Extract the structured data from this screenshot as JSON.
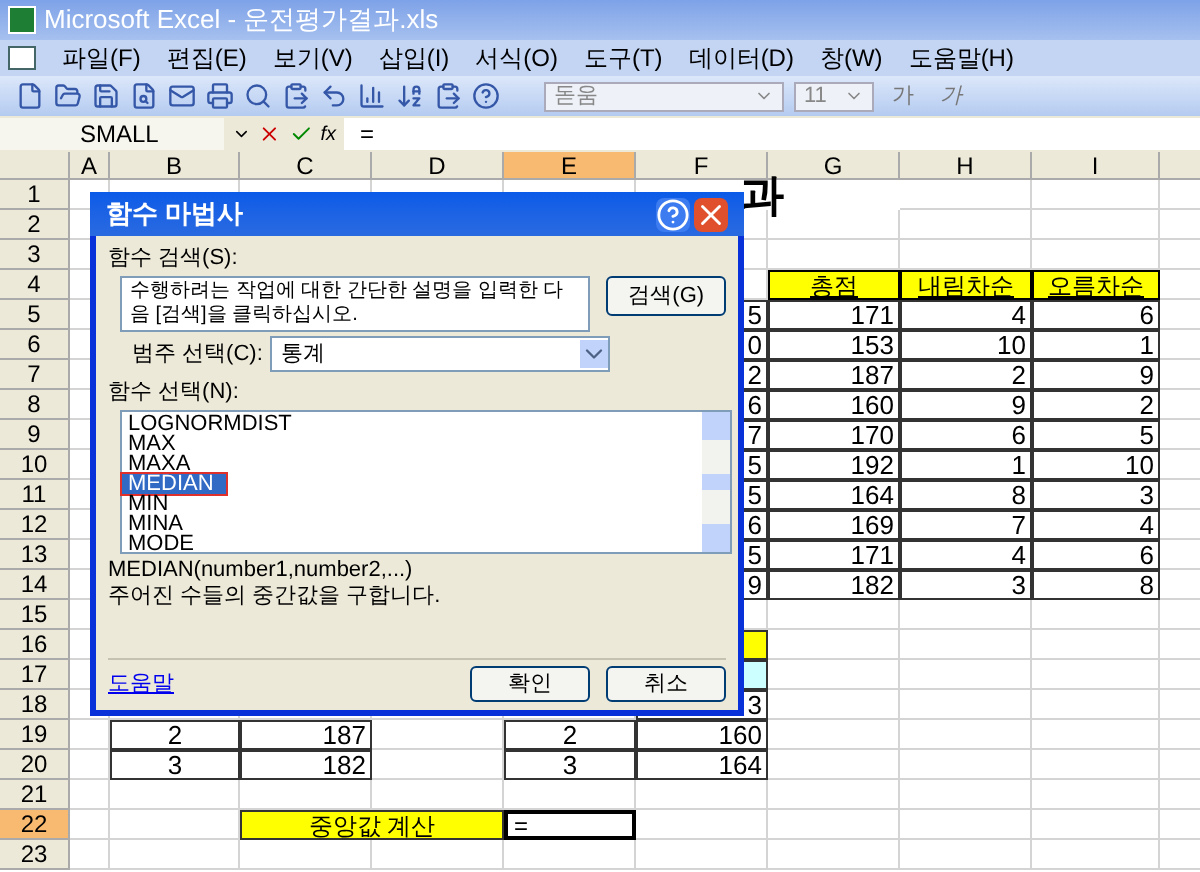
{
  "window": {
    "title": "Microsoft Excel - 운전평가결과.xls"
  },
  "menu": [
    "파일(F)",
    "편집(E)",
    "보기(V)",
    "삽입(I)",
    "서식(O)",
    "도구(T)",
    "데이터(D)",
    "창(W)",
    "도움말(H)"
  ],
  "font_toolbar": {
    "font": "돋움",
    "size": "11",
    "buttons": [
      "가",
      "가"
    ]
  },
  "formula_bar": {
    "name_box": "SMALL",
    "fx_button": "fx",
    "formula": "="
  },
  "columns": [
    {
      "label": "A",
      "selected": false
    },
    {
      "label": "B",
      "selected": false
    },
    {
      "label": "C",
      "selected": false
    },
    {
      "label": "D",
      "selected": false
    },
    {
      "label": "E",
      "selected": true
    },
    {
      "label": "F",
      "selected": false
    },
    {
      "label": "G",
      "selected": false
    },
    {
      "label": "H",
      "selected": false
    },
    {
      "label": "I",
      "selected": false
    }
  ],
  "rows": [
    {
      "label": "1",
      "selected": false,
      "cells": [
        {
          "kind": "empty"
        },
        {
          "kind": "empty"
        },
        {
          "kind": "empty"
        },
        {
          "kind": "empty"
        },
        {
          "kind": "empty"
        },
        {
          "kind": "title",
          "text": "과"
        }
      ]
    },
    {
      "label": "2",
      "selected": false
    },
    {
      "label": "3",
      "selected": false
    },
    {
      "label": "4",
      "selected": false,
      "cells": [
        {
          "kind": "empty"
        },
        {
          "kind": "empty"
        },
        {
          "kind": "empty"
        },
        {
          "kind": "empty"
        },
        {
          "kind": "empty"
        },
        {
          "kind": "empty"
        },
        {
          "kind": "header",
          "text": "총점"
        },
        {
          "kind": "header",
          "text": "내림차순"
        },
        {
          "kind": "header",
          "text": "오름차순"
        }
      ]
    },
    {
      "label": "5",
      "selected": false,
      "cells": [
        {
          "kind": "empty"
        },
        {
          "kind": "empty"
        },
        {
          "kind": "empty"
        },
        {
          "kind": "empty"
        },
        {
          "kind": "empty"
        },
        {
          "kind": "number",
          "text": "5"
        },
        {
          "kind": "number",
          "text": "171"
        },
        {
          "kind": "number",
          "text": "4"
        },
        {
          "kind": "number",
          "text": "6"
        }
      ]
    },
    {
      "label": "6",
      "selected": false,
      "cells": [
        {
          "kind": "empty"
        },
        {
          "kind": "empty"
        },
        {
          "kind": "empty"
        },
        {
          "kind": "empty"
        },
        {
          "kind": "empty"
        },
        {
          "kind": "number",
          "text": "0"
        },
        {
          "kind": "number",
          "text": "153"
        },
        {
          "kind": "number",
          "text": "10"
        },
        {
          "kind": "number",
          "text": "1"
        }
      ]
    },
    {
      "label": "7",
      "selected": false,
      "cells": [
        {
          "kind": "empty"
        },
        {
          "kind": "empty"
        },
        {
          "kind": "empty"
        },
        {
          "kind": "empty"
        },
        {
          "kind": "empty"
        },
        {
          "kind": "number",
          "text": "2"
        },
        {
          "kind": "number",
          "text": "187"
        },
        {
          "kind": "number",
          "text": "2"
        },
        {
          "kind": "number",
          "text": "9"
        }
      ]
    },
    {
      "label": "8",
      "selected": false,
      "cells": [
        {
          "kind": "empty"
        },
        {
          "kind": "empty"
        },
        {
          "kind": "empty"
        },
        {
          "kind": "empty"
        },
        {
          "kind": "empty"
        },
        {
          "kind": "number",
          "text": "6"
        },
        {
          "kind": "number",
          "text": "160"
        },
        {
          "kind": "number",
          "text": "9"
        },
        {
          "kind": "number",
          "text": "2"
        }
      ]
    },
    {
      "label": "9",
      "selected": false,
      "cells": [
        {
          "kind": "empty"
        },
        {
          "kind": "empty"
        },
        {
          "kind": "empty"
        },
        {
          "kind": "empty"
        },
        {
          "kind": "empty"
        },
        {
          "kind": "number",
          "text": "7"
        },
        {
          "kind": "number",
          "text": "170"
        },
        {
          "kind": "number",
          "text": "6"
        },
        {
          "kind": "number",
          "text": "5"
        }
      ]
    },
    {
      "label": "10",
      "selected": false,
      "cells": [
        {
          "kind": "empty"
        },
        {
          "kind": "empty"
        },
        {
          "kind": "empty"
        },
        {
          "kind": "empty"
        },
        {
          "kind": "empty"
        },
        {
          "kind": "number",
          "text": "5"
        },
        {
          "kind": "number",
          "text": "192"
        },
        {
          "kind": "number",
          "text": "1"
        },
        {
          "kind": "number",
          "text": "10"
        }
      ]
    },
    {
      "label": "11",
      "selected": false,
      "cells": [
        {
          "kind": "empty"
        },
        {
          "kind": "empty"
        },
        {
          "kind": "empty"
        },
        {
          "kind": "empty"
        },
        {
          "kind": "empty"
        },
        {
          "kind": "number",
          "text": "5"
        },
        {
          "kind": "number",
          "text": "164"
        },
        {
          "kind": "number",
          "text": "8"
        },
        {
          "kind": "number",
          "text": "3"
        }
      ]
    },
    {
      "label": "12",
      "selected": false,
      "cells": [
        {
          "kind": "empty"
        },
        {
          "kind": "empty"
        },
        {
          "kind": "empty"
        },
        {
          "kind": "empty"
        },
        {
          "kind": "empty"
        },
        {
          "kind": "number",
          "text": "6"
        },
        {
          "kind": "number",
          "text": "169"
        },
        {
          "kind": "number",
          "text": "7"
        },
        {
          "kind": "number",
          "text": "4"
        }
      ]
    },
    {
      "label": "13",
      "selected": false,
      "cells": [
        {
          "kind": "empty"
        },
        {
          "kind": "empty"
        },
        {
          "kind": "empty"
        },
        {
          "kind": "empty"
        },
        {
          "kind": "empty"
        },
        {
          "kind": "number",
          "text": "5"
        },
        {
          "kind": "number",
          "text": "171"
        },
        {
          "kind": "number",
          "text": "4"
        },
        {
          "kind": "number",
          "text": "6"
        }
      ]
    },
    {
      "label": "14",
      "selected": false,
      "cells": [
        {
          "kind": "empty"
        },
        {
          "kind": "empty"
        },
        {
          "kind": "empty"
        },
        {
          "kind": "empty"
        },
        {
          "kind": "empty"
        },
        {
          "kind": "number",
          "text": "9"
        },
        {
          "kind": "number",
          "text": "182"
        },
        {
          "kind": "number",
          "text": "3"
        },
        {
          "kind": "number",
          "text": "8"
        }
      ]
    },
    {
      "label": "15",
      "selected": false
    },
    {
      "label": "16",
      "selected": false,
      "cells": [
        {
          "kind": "empty"
        },
        {
          "kind": "empty"
        },
        {
          "kind": "empty"
        },
        {
          "kind": "empty"
        },
        {
          "kind": "empty"
        },
        {
          "kind": "yellow"
        }
      ]
    },
    {
      "label": "17",
      "selected": false,
      "cells": [
        {
          "kind": "empty"
        },
        {
          "kind": "empty"
        },
        {
          "kind": "empty"
        },
        {
          "kind": "empty"
        },
        {
          "kind": "empty"
        },
        {
          "kind": "cyan"
        }
      ]
    },
    {
      "label": "18",
      "selected": false,
      "cells": [
        {
          "kind": "empty"
        },
        {
          "kind": "empty"
        },
        {
          "kind": "empty"
        },
        {
          "kind": "empty"
        },
        {
          "kind": "empty"
        },
        {
          "kind": "number",
          "text": "3"
        }
      ]
    },
    {
      "label": "19",
      "selected": false,
      "cells": [
        {
          "kind": "empty"
        },
        {
          "kind": "center",
          "text": "2"
        },
        {
          "kind": "number",
          "text": "187"
        },
        {
          "kind": "empty"
        },
        {
          "kind": "center",
          "text": "2"
        },
        {
          "kind": "number",
          "text": "160"
        }
      ]
    },
    {
      "label": "20",
      "selected": false,
      "cells": [
        {
          "kind": "empty"
        },
        {
          "kind": "center",
          "text": "3"
        },
        {
          "kind": "number",
          "text": "182"
        },
        {
          "kind": "empty"
        },
        {
          "kind": "center",
          "text": "3"
        },
        {
          "kind": "number",
          "text": "164"
        }
      ]
    },
    {
      "label": "21",
      "selected": false
    },
    {
      "label": "22",
      "selected": true,
      "cells": [
        {
          "kind": "empty"
        },
        {
          "kind": "empty"
        },
        {
          "kind": "label",
          "text": "중앙값 계산"
        },
        {
          "kind": "active",
          "text": "="
        }
      ]
    },
    {
      "label": "23",
      "selected": false
    }
  ],
  "dialog": {
    "title": "함수 마법사",
    "search_label": "함수 검색(S):",
    "search_value": "수행하려는 작업에 대한 간단한 설명을 입력한 다음 [검색]을 클릭하십시오.",
    "search_button": "검색(G)",
    "category_label": "범주 선택(C):",
    "category_value": "통계",
    "function_label": "함수 선택(N):",
    "functions": [
      {
        "name": "LOGNORMDIST",
        "selected": false,
        "marked": false
      },
      {
        "name": "MAX",
        "selected": false,
        "marked": false
      },
      {
        "name": "MAXA",
        "selected": false,
        "marked": false
      },
      {
        "name": "MEDIAN",
        "selected": true,
        "marked": true
      },
      {
        "name": "MIN",
        "selected": false,
        "marked": false
      },
      {
        "name": "MINA",
        "selected": false,
        "marked": false
      },
      {
        "name": "MODE",
        "selected": false,
        "marked": false
      }
    ],
    "signature": "MEDIAN(number1,number2,...)",
    "description": "주어진 수들의 중간값을 구합니다.",
    "help_link": "도움말",
    "buttons": [
      "확인",
      "취소"
    ]
  }
}
